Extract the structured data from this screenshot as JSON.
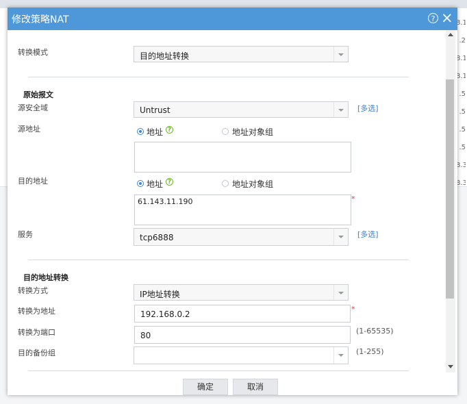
{
  "dialog": {
    "title": "修改策略NAT",
    "help_icon": "question-circle-icon",
    "close_icon": "close-icon"
  },
  "background_table": {
    "right_edge_values": [
      "8.1",
      ".2",
      "8.1",
      "8.1",
      ".5",
      ".5",
      ".5",
      ".5",
      "8.3",
      "8.3"
    ]
  },
  "form": {
    "mode_label": "转换模式",
    "mode_value": "目的地址转换",
    "original_packet": {
      "section_title": "原始报文",
      "src_zone_label": "源安全域",
      "src_zone_value": "Untrust",
      "multi_select_label": "[多选]",
      "src_addr_label": "源地址",
      "addr_option": "地址",
      "addr_group_option": "地址对象组",
      "src_addr_value": "",
      "dst_addr_label": "目的地址",
      "dst_addr_value": "61.143.11.190",
      "service_label": "服务",
      "service_value": "tcp6888",
      "service_multi_label": "[多选]"
    },
    "dst_translation": {
      "section_title": "目的地址转换",
      "method_label": "转换方式",
      "method_value": "IP地址转换",
      "to_addr_label": "转换为地址",
      "to_addr_value": "192.168.0.2",
      "to_port_label": "转换为端口",
      "to_port_value": "80",
      "port_range_hint": "(1-65535)",
      "backup_group_label": "目的备份组",
      "backup_group_value": "",
      "backup_range_hint": "(1-255)"
    },
    "required_mark": "*"
  },
  "footer": {
    "ok_label": "确定",
    "cancel_label": "取消"
  },
  "colors": {
    "titlebar": "#4e97d8",
    "link": "#3a7fd0",
    "help_green": "#6fb82a",
    "required": "#e03b3b"
  }
}
